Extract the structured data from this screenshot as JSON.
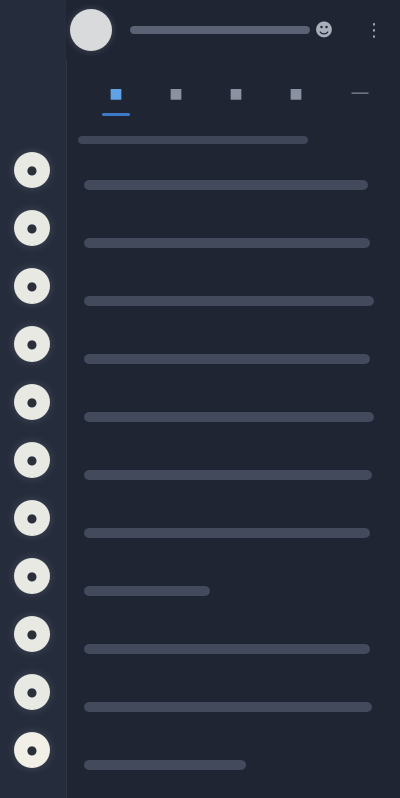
{
  "header": {
    "title": "",
    "icons": [
      "group-icon",
      "menu-icon"
    ]
  },
  "tabs": [
    {
      "name": "tab-chats",
      "icon": "chat-icon"
    },
    {
      "name": "tab-contacts",
      "icon": "contacts-icon"
    },
    {
      "name": "tab-calls",
      "icon": "calls-icon"
    },
    {
      "name": "tab-favorites",
      "icon": "star-icon"
    },
    {
      "name": "tab-more",
      "icon": "more-icon"
    }
  ],
  "rail": [
    {
      "name": "rail-item-1"
    },
    {
      "name": "rail-item-2"
    },
    {
      "name": "rail-item-3"
    },
    {
      "name": "rail-item-4"
    },
    {
      "name": "rail-item-5"
    },
    {
      "name": "rail-item-6"
    },
    {
      "name": "rail-item-7"
    },
    {
      "name": "rail-item-8"
    },
    {
      "name": "rail-item-9"
    },
    {
      "name": "rail-item-10"
    },
    {
      "name": "rail-item-11"
    }
  ],
  "list": {
    "header": "",
    "items": [
      {
        "label": ""
      },
      {
        "label": ""
      },
      {
        "label": ""
      },
      {
        "label": ""
      },
      {
        "label": ""
      },
      {
        "label": ""
      },
      {
        "label": ""
      },
      {
        "label": ""
      },
      {
        "label": ""
      },
      {
        "label": ""
      },
      {
        "label": ""
      }
    ]
  },
  "colors": {
    "background": "#1f2533",
    "rail": "#252c3b",
    "accent": "#3c79c9",
    "avatar": "#e9e9e4"
  }
}
